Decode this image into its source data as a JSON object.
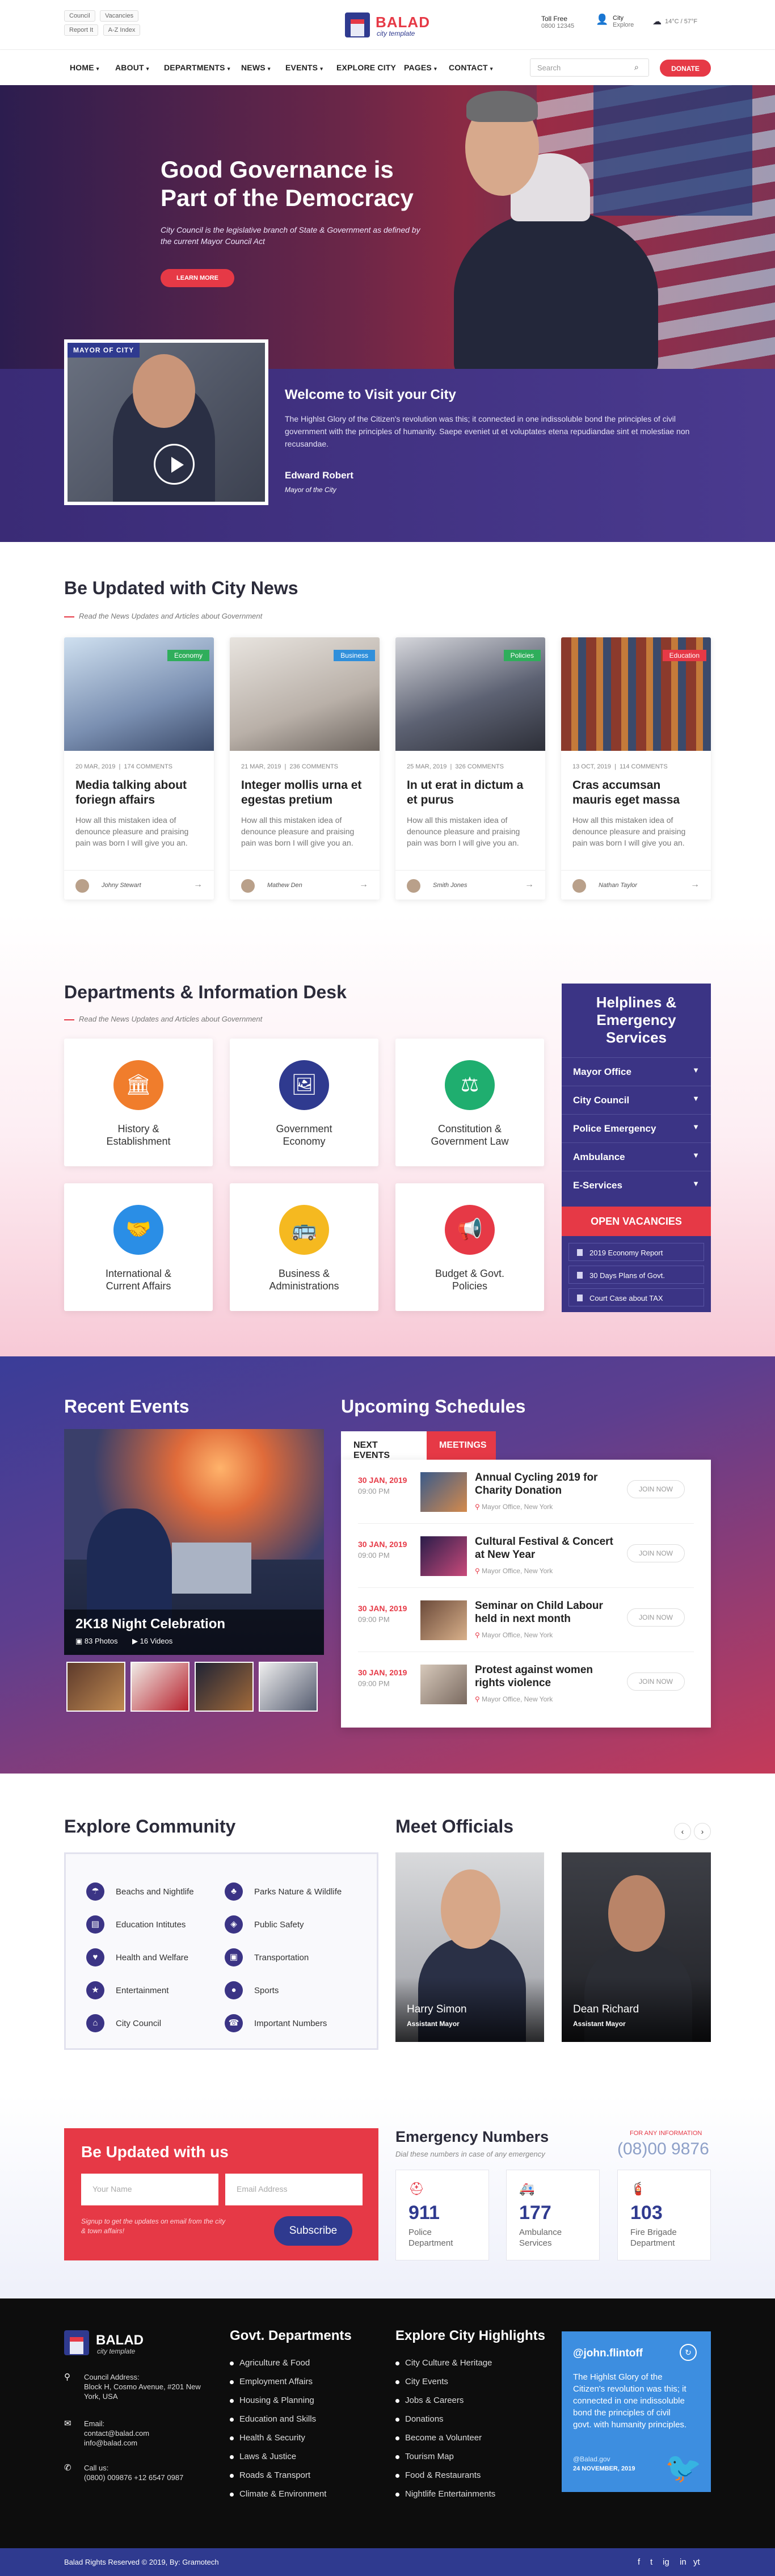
{
  "topbar": {
    "chips": [
      "Council",
      "Vacancies",
      "Report It",
      "A-Z Index"
    ],
    "brand": "BALAD",
    "brand_sub": "city template",
    "toll_label": "Toll Free",
    "toll_value": "0800 12345",
    "city_label": "City",
    "city_value": "Explore",
    "weather": "14°C / 57°F"
  },
  "nav": {
    "items": [
      "HOME",
      "ABOUT",
      "DEPARTMENTS",
      "NEWS",
      "EVENTS",
      "EXPLORE CITY",
      "PAGES",
      "CONTACT"
    ],
    "search_placeholder": "Search",
    "donate": "DONATE"
  },
  "hero": {
    "title_line1": "Good Governance is",
    "title_line2": "Part of the Democracy",
    "text": "City Council is the legislative branch of State & Government as defined by the current Mayor Council Act",
    "button": "LEARN MORE"
  },
  "welcome": {
    "video_label": "MAYOR OF CITY",
    "title": "Welcome to Visit your City",
    "text": "The Highlst Glory of the Citizen's revolution was this; it connected in one indissoluble bond the principles of civil government with the principles of humanity. Saepe eveniet ut et voluptates etena repudiandae sint et molestiae non recusandae.",
    "name": "Edward Robert",
    "role": "Mayor of the City"
  },
  "news": {
    "title": "Be Updated with City News",
    "subtitle": "Read the News Updates and Articles about Government",
    "cards": [
      {
        "tag": "Economy",
        "tag_color": "#2fae5b",
        "date": "20 MAR, 2019",
        "comments": "174 COMMENTS",
        "title": "Media talking about foriegn affairs",
        "body": "How all this mistaken idea of denounce pleasure and praising pain was born I will give you an.",
        "author": "Johny Stewart"
      },
      {
        "tag": "Business",
        "tag_color": "#2f8fdb",
        "date": "21 MAR, 2019",
        "comments": "236 COMMENTS",
        "title": "Integer mollis urna et egestas pretium",
        "body": "How all this mistaken idea of denounce pleasure and praising pain was born I will give you an.",
        "author": "Mathew Den"
      },
      {
        "tag": "Policies",
        "tag_color": "#2fae5b",
        "date": "25 MAR, 2019",
        "comments": "326 COMMENTS",
        "title": "In ut erat in dictum a et purus",
        "body": "How all this mistaken idea of denounce pleasure and praising pain was born I will give you an.",
        "author": "Smith Jones"
      },
      {
        "tag": "Education",
        "tag_color": "#e63946",
        "date": "13 OCT, 2019",
        "comments": "114 COMMENTS",
        "title": "Cras accumsan mauris eget massa",
        "body": "How all this mistaken idea of denounce pleasure and praising pain was born I will give you an.",
        "author": "Nathan Taylor"
      }
    ]
  },
  "departments": {
    "title": "Departments & Information Desk",
    "subtitle": "Read the News Updates and Articles about Government",
    "items": [
      {
        "label1": "History &",
        "label2": "Establishment",
        "icon": "building-icon",
        "color": "#f07d2c"
      },
      {
        "label1": "Government",
        "label2": "Economy",
        "icon": "chart-icon",
        "color": "#2f3a8f"
      },
      {
        "label1": "Constitution &",
        "label2": "Government Law",
        "icon": "gavel-icon",
        "color": "#1fae6f"
      },
      {
        "label1": "International &",
        "label2": "Current Affairs",
        "icon": "handshake-icon",
        "color": "#2a8ee6"
      },
      {
        "label1": "Business &",
        "label2": "Administrations",
        "icon": "bus-icon",
        "color": "#f5b920"
      },
      {
        "label1": "Budget & Govt.",
        "label2": "Policies",
        "icon": "megaphone-icon",
        "color": "#e63946"
      }
    ],
    "help_title_1": "Helplines &",
    "help_title_2": "Emergency",
    "help_title_3": "Services",
    "help_items": [
      "Mayor Office",
      "City Council",
      "Police Emergency",
      "Ambulance",
      "E-Services"
    ],
    "vacancies": "OPEN VACANCIES",
    "vacancy_items": [
      "2019 Economy Report",
      "30 Days Plans of Govt.",
      "Court Case about TAX"
    ]
  },
  "events": {
    "recent_title": "Recent Events",
    "recent_name": "2K18 Night Celebration",
    "photos": "83 Photos",
    "videos": "16 Videos",
    "upcoming_title": "Upcoming Schedules",
    "tab_next": "NEXT EVENTS",
    "tab_meetings": "MEETINGS",
    "schedules": [
      {
        "date": "30 JAN, 2019",
        "time": "09:00 PM",
        "title": "Annual Cycling 2019 for Charity Donation",
        "location": "Mayor Office, New York",
        "join": "JOIN NOW"
      },
      {
        "date": "30 JAN, 2019",
        "time": "09:00 PM",
        "title": "Cultural Festival & Concert at New Year",
        "location": "Mayor Office, New York",
        "join": "JOIN NOW"
      },
      {
        "date": "30 JAN, 2019",
        "time": "09:00 PM",
        "title": "Seminar on Child Labour held in next month",
        "location": "Mayor Office, New York",
        "join": "JOIN NOW"
      },
      {
        "date": "30 JAN, 2019",
        "time": "09:00 PM",
        "title": "Protest against women rights violence",
        "location": "Mayor Office, New York",
        "join": "JOIN NOW"
      }
    ]
  },
  "community": {
    "title": "Explore Community",
    "left": [
      "Beachs and Nightlife",
      "Education Intitutes",
      "Health and Welfare",
      "Entertainment",
      "City Council"
    ],
    "right": [
      "Parks Nature & Wildlife",
      "Public Safety",
      "Transportation",
      "Sports",
      "Important Numbers"
    ]
  },
  "officials": {
    "title": "Meet Officials",
    "people": [
      {
        "name": "Harry Simon",
        "role": "Assistant Mayor"
      },
      {
        "name": "Dean Richard",
        "role": "Assistant Mayor"
      }
    ]
  },
  "newsletter": {
    "title": "Be Updated with us",
    "name_placeholder": "Your Name",
    "email_placeholder": "Email Address",
    "note": "Signup to get the updates on email from the city & town affairs!",
    "button": "Subscribe"
  },
  "emergency": {
    "title": "Emergency Numbers",
    "subtitle": "Dial these numbers in case of any emergency",
    "for_any": "FOR ANY INFORMATION",
    "info_number": "(08)00 9876",
    "boxes": [
      {
        "number": "911",
        "label1": "Police",
        "label2": "Department"
      },
      {
        "number": "177",
        "label1": "Ambulance",
        "label2": "Services"
      },
      {
        "number": "103",
        "label1": "Fire Brigade",
        "label2": "Department"
      }
    ]
  },
  "footer": {
    "brand": "BALAD",
    "brand_sub": "city template",
    "address_label": "Council Address:",
    "address": "Block H, Cosmo Avenue, #201 New York, USA",
    "email_label": "Email:",
    "email1": "contact@balad.com",
    "email2": "info@balad.com",
    "call_label": "Call us:",
    "phones": "(0800) 009876 +12 6547 0987",
    "depts_title": "Govt. Departments",
    "depts": [
      "Agriculture & Food",
      "Employment Affairs",
      "Housing & Planning",
      "Education and Skills",
      "Health & Security",
      "Laws & Justice",
      "Roads & Transport",
      "Climate & Environment"
    ],
    "highlights_title": "Explore City Highlights",
    "highlights": [
      "City Culture & Heritage",
      "City Events",
      "Jobs & Careers",
      "Donations",
      "Become a Volunteer",
      "Tourism Map",
      "Food & Restaurants",
      "Nightlife Entertainments"
    ],
    "tweet_handle": "@john.flintoff",
    "tweet_text": "The Highlst Glory of the Citizen's revolution was this; it connected in one indissoluble bond the principles of civil govt. with humanity principles.",
    "tweet_by": "@Balad.gov",
    "tweet_date": "24 NOVEMBER, 2019",
    "copyright": "Balad Rights Reserved © 2019, By: Gramotech",
    "social": [
      "f",
      "t",
      "ig",
      "in",
      "yt"
    ]
  }
}
